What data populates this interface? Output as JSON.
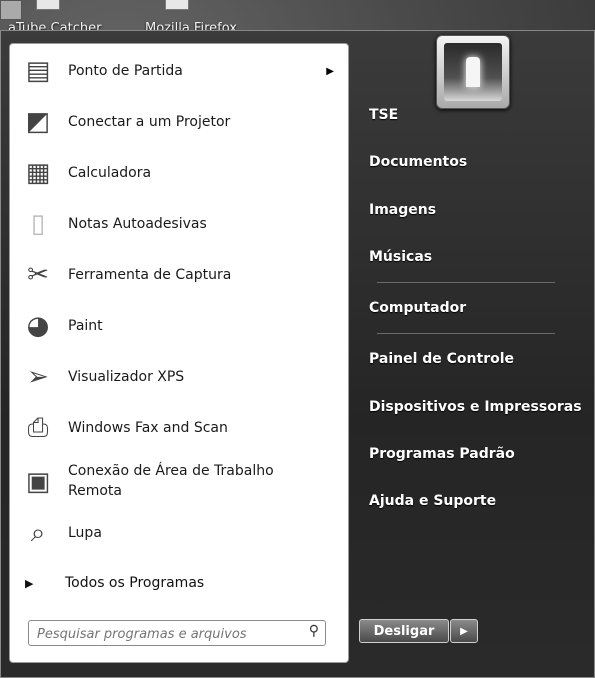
{
  "desktop": {
    "icons": [
      {
        "label": "aTube Catcher",
        "icon": "video-app-icon"
      },
      {
        "label": "Mozilla Firefox",
        "icon": "firefox-icon"
      }
    ]
  },
  "left_pane": {
    "programs": [
      {
        "label": "Ponto de Partida",
        "icon": "getting-started-icon",
        "has_submenu": true
      },
      {
        "label": "Conectar a um Projetor",
        "icon": "projector-icon"
      },
      {
        "label": "Calculadora",
        "icon": "calculator-icon"
      },
      {
        "label": "Notas Autoadesivas",
        "icon": "sticky-notes-icon"
      },
      {
        "label": "Ferramenta de Captura",
        "icon": "scissors-icon"
      },
      {
        "label": "Paint",
        "icon": "palette-icon"
      },
      {
        "label": "Visualizador XPS",
        "icon": "xps-viewer-icon"
      },
      {
        "label": "Windows Fax and Scan",
        "icon": "fax-icon"
      },
      {
        "label": "Conexão de Área de Trabalho Remota",
        "label_line1": "Conexão de Área de Trabalho",
        "label_line2": "Remota",
        "icon": "remote-desktop-icon"
      },
      {
        "label": "Lupa",
        "icon": "magnifier-icon"
      }
    ],
    "all_programs": "Todos os Programas",
    "search_placeholder": "Pesquisar programas e arquivos"
  },
  "right_pane": {
    "items": [
      "TSE",
      "Documentos",
      "Imagens",
      "Músicas",
      "Computador",
      "Painel de Controle",
      "Dispositivos e Impressoras",
      "Programas Padrão",
      "Ajuda e Suporte"
    ],
    "shutdown_label": "Desligar"
  }
}
